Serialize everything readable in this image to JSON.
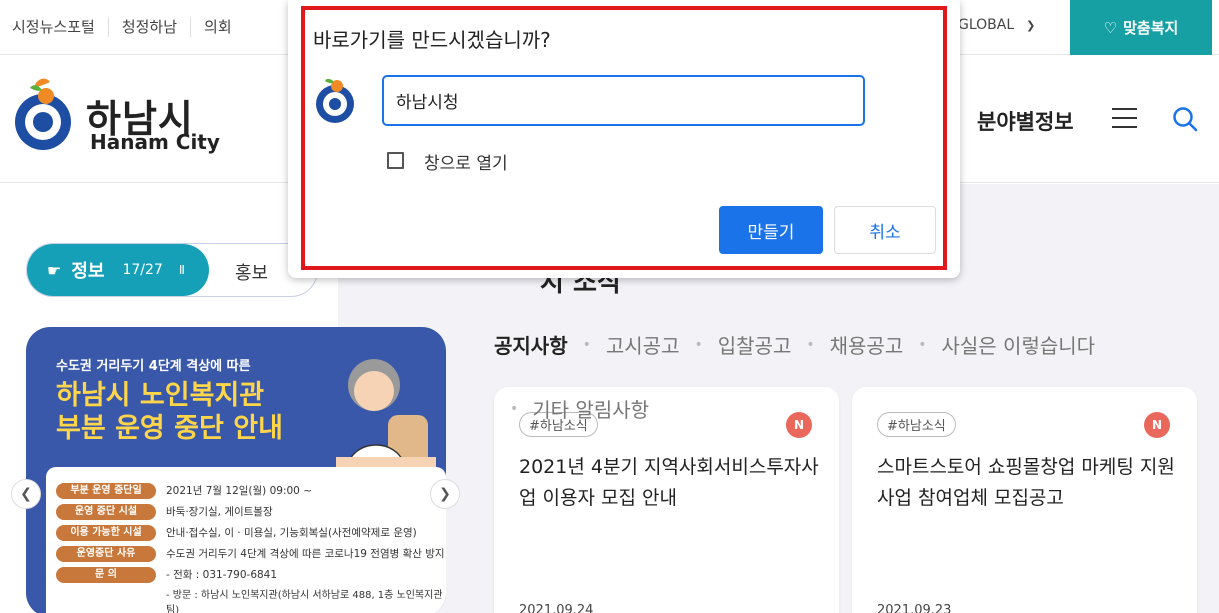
{
  "topbar": {
    "links": [
      "시정뉴스포털",
      "청정하남",
      "의회"
    ],
    "global_label": "GLOBAL",
    "welfare_button": "맞춤복지"
  },
  "header": {
    "logo_kr": "하남시",
    "logo_en": "Hanam City",
    "field_info": "분야별정보"
  },
  "info_pill": {
    "active_label": "정보",
    "counter": "17/27",
    "pause": "II",
    "inactive_label": "홍보"
  },
  "banner": {
    "subtitle": "수도권 거리두기 4단계 격상에 따른",
    "title_line1": "하남시 노인복지관",
    "title_line2": "부분 운영 중단 안내",
    "rows": [
      {
        "tag": "부분 운영 중단일",
        "value": "2021년 7월 12일(월) 09:00 ~"
      },
      {
        "tag": "운영 중단 시설",
        "value": "바둑·장기실, 게이트볼장"
      },
      {
        "tag": "이용 가능한 시설",
        "value": "안내·접수실, 이 · 미용실, 기능회복실(사전예약제로 운영)"
      },
      {
        "tag": "운영중단 사유",
        "value": "수도권 거리두기 4단계 격상에 따른 코로나19 전염병 확산 방지"
      },
      {
        "tag": "문 의",
        "value": "- 전화 : 031-790-6841"
      }
    ],
    "extra": "- 방문 : 하남시 노인복지관(하남시 서하남로 488, 1층 노인복지관팀)"
  },
  "notice": {
    "title": "시 소식",
    "tabs": [
      "공지사항",
      "고시공고",
      "입찰공고",
      "채용공고",
      "사실은 이렇습니다"
    ],
    "extra_tab": "기타 알림사항"
  },
  "cards": [
    {
      "hash": "#하남소식",
      "badge": "N",
      "title": "2021년 4분기 지역사회서비스투자사업 이용자 모집 안내",
      "date": "2021.09.24"
    },
    {
      "hash": "#하남소식",
      "badge": "N",
      "title": "스마트스토어 쇼핑몰창업 마케팅 지원사업 참여업체 모집공고",
      "date": "2021.09.23"
    }
  ],
  "dialog": {
    "title": "바로가기를 만드시겠습니까?",
    "input_value": "하남시청",
    "checkbox_label": "창으로 열기",
    "create_button": "만들기",
    "cancel_button": "취소"
  },
  "colors": {
    "teal": "#16a0a4",
    "banner_blue": "#3a58a9",
    "chrome_blue": "#1a73e8",
    "highlight_red": "#e0171b"
  }
}
